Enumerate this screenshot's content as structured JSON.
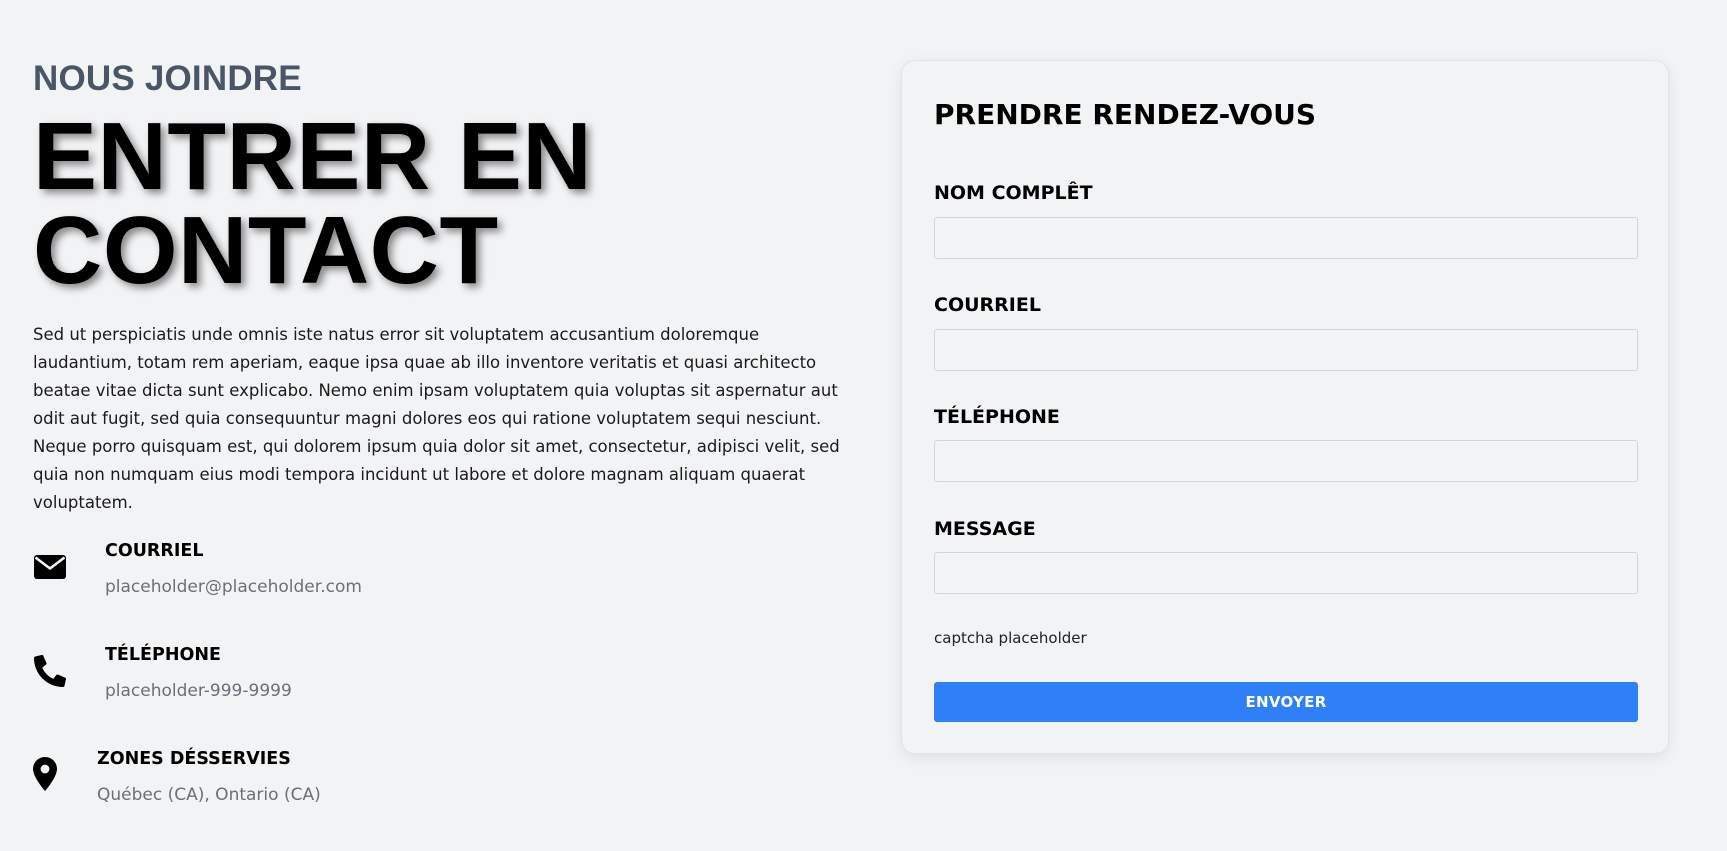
{
  "hero": {
    "eyebrow": "NOUS JOINDRE",
    "headline_line1": "ENTRER EN",
    "headline_line2": "CONTACT",
    "intro": "Sed ut perspiciatis unde omnis iste natus error sit voluptatem accusantium doloremque laudantium, totam rem aperiam, eaque ipsa quae ab illo inventore veritatis et quasi architecto beatae vitae dicta sunt explicabo. Nemo enim ipsam voluptatem quia voluptas sit aspernatur aut odit aut fugit, sed quia consequuntur magni dolores eos qui ratione voluptatem sequi nesciunt. Neque porro quisquam est, qui dolorem ipsum quia dolor sit amet, consectetur, adipisci velit, sed quia non numquam eius modi tempora incidunt ut labore et dolore magnam aliquam quaerat voluptatem."
  },
  "contact": {
    "email": {
      "label": "COURRIEL",
      "value": "placeholder@placeholder.com",
      "icon": "envelope-icon"
    },
    "phone": {
      "label": "TÉLÉPHONE",
      "value": "placeholder-999-9999",
      "icon": "phone-icon"
    },
    "zones": {
      "label": "ZONES DÉSSERVIES",
      "value": "Québec (CA), Ontario (CA)",
      "icon": "map-pin-icon"
    }
  },
  "form": {
    "title": "PRENDRE RENDEZ-VOUS",
    "fields": [
      {
        "label": "NOM COMPLÊT",
        "value": ""
      },
      {
        "label": "COURRIEL",
        "value": ""
      },
      {
        "label": "TÉLÉPHONE",
        "value": ""
      },
      {
        "label": "MESSAGE",
        "value": ""
      }
    ],
    "captcha": "captcha placeholder",
    "submit_label": "ENVOYER"
  },
  "colors": {
    "background": "#f2f3f5",
    "eyebrow": "#4a5566",
    "accent_button": "#2f7ff7",
    "muted_text": "#6b6f78"
  }
}
